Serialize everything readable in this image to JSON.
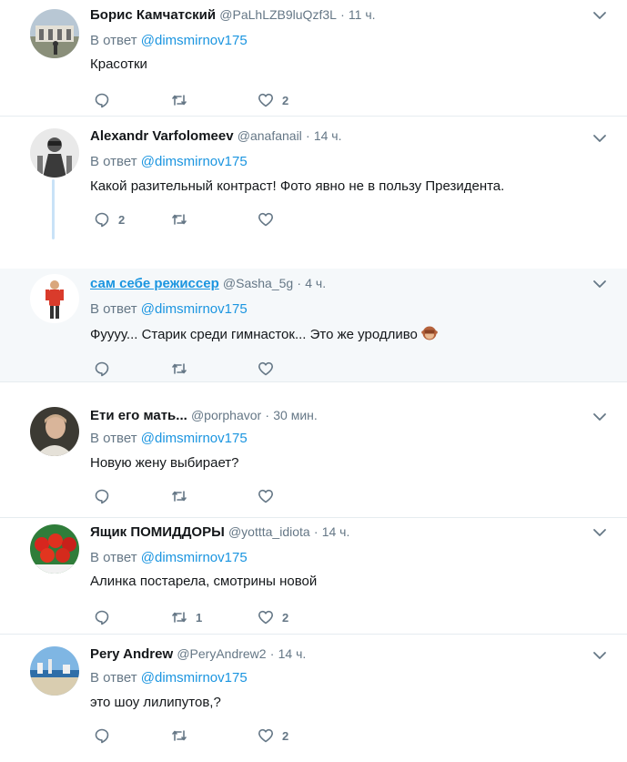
{
  "ui": {
    "reply_to_prefix": "В ответ ",
    "accent": "#1b95e0",
    "muted": "#657786",
    "highlight_bg": "#f5f8fa"
  },
  "tweets": [
    {
      "name": "Борис Камчатский",
      "handle": "@PaLhLZB9luQzf3L",
      "sep": "·",
      "time": "11 ч.",
      "mention": "@dimsmirnov175",
      "text": "Красотки",
      "replies": "",
      "retweets": "",
      "likes": "2"
    },
    {
      "name": "Alexandr Varfolomeev",
      "handle": "@anafanail",
      "sep": "·",
      "time": "14 ч.",
      "mention": "@dimsmirnov175",
      "text": "Какой разительный контраст! Фото явно не в пользу Президента.",
      "replies": "2",
      "retweets": "",
      "likes": ""
    },
    {
      "name": "сам себе режиссер",
      "handle": "@Sasha_5g",
      "sep": "·",
      "time": "4 ч.",
      "mention": "@dimsmirnov175",
      "text": "Фуууу... Старик среди гимнасток... Это же уродливо",
      "emoji": "see-no-evil-monkey",
      "replies": "",
      "retweets": "",
      "likes": ""
    },
    {
      "name": "Ети его мать...",
      "handle": "@porphavor",
      "sep": "·",
      "time": "30 мин.",
      "mention": "@dimsmirnov175",
      "text": "Новую жену выбирает?",
      "replies": "",
      "retweets": "",
      "likes": ""
    },
    {
      "name": "Ящик ПОМИДДОРЫ",
      "handle": "@yottta_idiota",
      "sep": "·",
      "time": "14 ч.",
      "mention": "@dimsmirnov175",
      "text": "Алинка постарела, смотрины новой",
      "replies": "",
      "retweets": "1",
      "likes": "2"
    },
    {
      "name": "Pery Andrew",
      "handle": "@PeryAndrew2",
      "sep": "·",
      "time": "14 ч.",
      "mention": "@dimsmirnov175",
      "text": "это шоу лилипутов,?",
      "replies": "",
      "retweets": "",
      "likes": "2"
    }
  ]
}
